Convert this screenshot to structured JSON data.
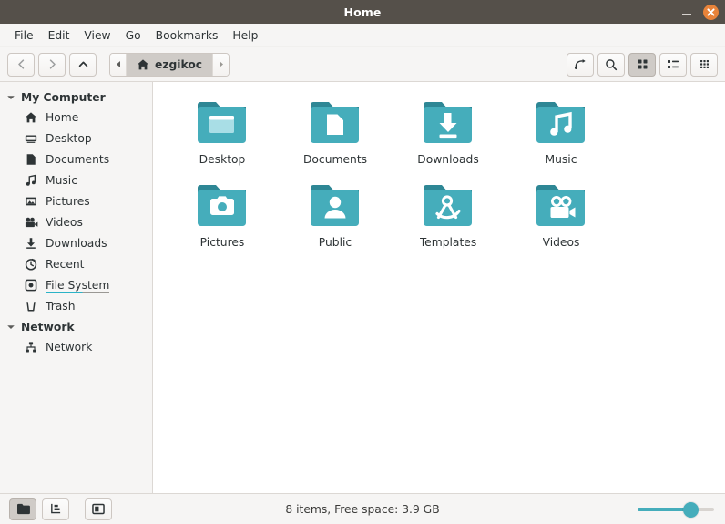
{
  "window": {
    "title": "Home",
    "minimize_label": "Minimize",
    "close_label": "Close",
    "close_color": "#e8833a",
    "titlebar_color": "#55504a"
  },
  "menubar": {
    "items": [
      {
        "label": "File"
      },
      {
        "label": "Edit"
      },
      {
        "label": "View"
      },
      {
        "label": "Go"
      },
      {
        "label": "Bookmarks"
      },
      {
        "label": "Help"
      }
    ]
  },
  "toolbar": {
    "back_label": "Back",
    "forward_label": "Forward",
    "up_label": "Up",
    "reload_label": "Reload",
    "search_label": "Search",
    "icon_view_label": "Icon View",
    "list_view_label": "List View",
    "compact_view_label": "Compact View",
    "active_view": "icon-view"
  },
  "breadcrumb": {
    "prev_label": "Previous",
    "next_label": "Next",
    "current": "ezgikoc",
    "current_icon": "home-icon"
  },
  "sidebar": {
    "groups": [
      {
        "label": "My Computer",
        "items": [
          {
            "label": "Home",
            "icon": "home-icon",
            "state": "normal"
          },
          {
            "label": "Desktop",
            "icon": "desktop-icon",
            "state": "normal"
          },
          {
            "label": "Documents",
            "icon": "document-icon",
            "state": "normal"
          },
          {
            "label": "Music",
            "icon": "music-note-icon",
            "state": "normal"
          },
          {
            "label": "Pictures",
            "icon": "image-icon",
            "state": "normal"
          },
          {
            "label": "Videos",
            "icon": "video-camera-icon",
            "state": "normal"
          },
          {
            "label": "Downloads",
            "icon": "download-icon",
            "state": "normal"
          },
          {
            "label": "Recent",
            "icon": "clock-icon",
            "state": "normal"
          },
          {
            "label": "File System",
            "icon": "drive-icon",
            "state": "hovered"
          },
          {
            "label": "Trash",
            "icon": "trash-icon",
            "state": "normal"
          }
        ]
      },
      {
        "label": "Network",
        "items": [
          {
            "label": "Network",
            "icon": "network-icon",
            "state": "normal"
          }
        ]
      }
    ],
    "accent_color": "#2ab3c7"
  },
  "content": {
    "folder_color": "#45adbb",
    "folder_tab_color": "#2e8795",
    "items": [
      {
        "label": "Desktop",
        "icon": "folder-desktop-icon"
      },
      {
        "label": "Documents",
        "icon": "folder-documents-icon"
      },
      {
        "label": "Downloads",
        "icon": "folder-downloads-icon"
      },
      {
        "label": "Music",
        "icon": "folder-music-icon"
      },
      {
        "label": "Pictures",
        "icon": "folder-pictures-icon"
      },
      {
        "label": "Public",
        "icon": "folder-public-icon"
      },
      {
        "label": "Templates",
        "icon": "folder-templates-icon"
      },
      {
        "label": "Videos",
        "icon": "folder-videos-icon"
      }
    ]
  },
  "statusbar": {
    "icon_view_toggle_label": "Folder view",
    "tree_view_toggle_label": "Tree view",
    "sidebar_toggle_label": "Toggle sidebar",
    "status_text": "8 items, Free space: 3.9 GB",
    "zoom_percent": 75,
    "zoom_color": "#45adbb"
  }
}
